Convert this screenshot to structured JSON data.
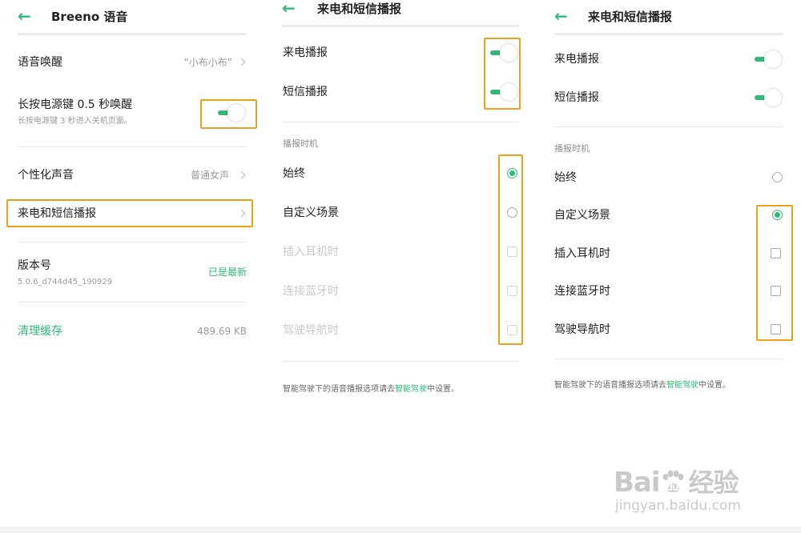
{
  "panel1": {
    "title": "Breeno 语音",
    "wake": {
      "label": "语音唤醒",
      "value": "“小布小布”"
    },
    "power_key": {
      "label": "长按电源键 0.5 秒唤醒",
      "sub": "长按电源键 3 秒进入关机页面。"
    },
    "voice": {
      "label": "个性化声音",
      "value": "普通女声"
    },
    "broadcast": {
      "label": "来电和短信播报"
    },
    "version": {
      "label": "版本号",
      "number": "5.0.6_d744d45_190929",
      "status": "已是最新"
    },
    "cache": {
      "label": "清理缓存",
      "size": "489.69 KB"
    }
  },
  "panel2": {
    "title": "来电和短信播报",
    "call": {
      "label": "来电播报"
    },
    "sms": {
      "label": "短信播报"
    },
    "section": "播报时机",
    "options": [
      "始终",
      "自定义场景",
      "插入耳机时",
      "连接蓝牙时",
      "驾驶导航时"
    ],
    "footer": {
      "before": "智能驾驶下的语音播报选项请去",
      "link": "智能驾驶",
      "after": "中设置。"
    }
  },
  "panel3": {
    "title": "来电和短信播报",
    "call": {
      "label": "来电播报"
    },
    "sms": {
      "label": "短信播报"
    },
    "section": "播报时机",
    "options": [
      "始终",
      "自定义场景",
      "插入耳机时",
      "连接蓝牙时",
      "驾驶导航时"
    ],
    "footer": {
      "before": "智能驾驶下的语音播报选项请去",
      "link": "智能驾驶",
      "after": "中设置。"
    }
  },
  "watermark": {
    "brand_left": "Bai",
    "brand_mid": "du",
    "brand_right": "经验",
    "url": "jingyan.baidu.com"
  },
  "icons": {
    "back": "back-arrow-icon",
    "chevron": "chevron-right-icon",
    "toggle": "toggle-on",
    "radio": "radio",
    "checkbox": "checkbox",
    "paw": "baidu-paw-icon"
  },
  "colors": {
    "accent": "#2fba7a",
    "highlight": "#eba21a",
    "disabled": "#c8c8c8"
  }
}
